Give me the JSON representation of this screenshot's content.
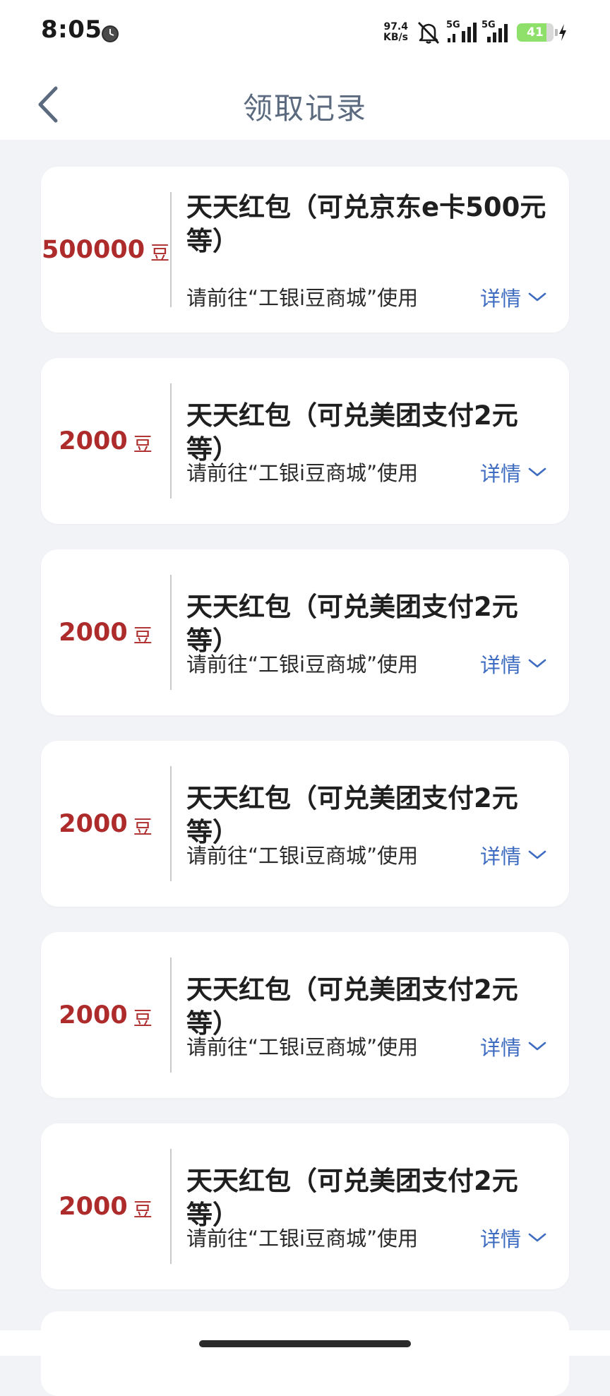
{
  "status_bar": {
    "time": "8:05",
    "net_speed_value": "97.4",
    "net_speed_unit": "KB/s",
    "signal1_label": "5G",
    "signal2_label": "5G",
    "battery_level": "41"
  },
  "header": {
    "title": "领取记录"
  },
  "records": [
    {
      "amount": "500000",
      "unit": "豆",
      "title": "天天红包（可兑京东e卡500元等）",
      "subtitle": "请前往“工银i豆商城”使用",
      "details_label": "详情"
    },
    {
      "amount": "2000",
      "unit": "豆",
      "title": "天天红包（可兑美团支付2元等）",
      "subtitle": "请前往“工银i豆商城”使用",
      "details_label": "详情"
    },
    {
      "amount": "2000",
      "unit": "豆",
      "title": "天天红包（可兑美团支付2元等）",
      "subtitle": "请前往“工银i豆商城”使用",
      "details_label": "详情"
    },
    {
      "amount": "2000",
      "unit": "豆",
      "title": "天天红包（可兑美团支付2元等）",
      "subtitle": "请前往“工银i豆商城”使用",
      "details_label": "详情"
    },
    {
      "amount": "2000",
      "unit": "豆",
      "title": "天天红包（可兑美团支付2元等）",
      "subtitle": "请前往“工银i豆商城”使用",
      "details_label": "详情"
    },
    {
      "amount": "2000",
      "unit": "豆",
      "title": "天天红包（可兑美团支付2元等）",
      "subtitle": "请前往“工银i豆商城”使用",
      "details_label": "详情"
    }
  ],
  "colors": {
    "amount": "#ad2b2b",
    "link": "#3d6cc0",
    "title": "#5b6a7e",
    "background": "#f1f3f6"
  }
}
